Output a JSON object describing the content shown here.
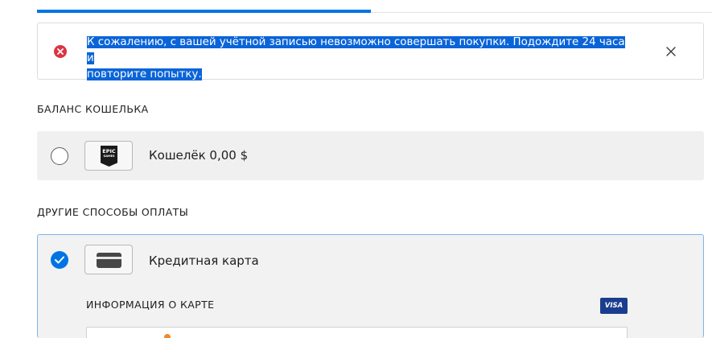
{
  "alert": {
    "type": "error",
    "message_line1": "К сожалению, с вашей учётной записью невозможно совершать покупки. Подождите 24 часа и",
    "message_line2": "повторите попытку.",
    "icons": {
      "status": "error-x-icon",
      "close": "close-icon"
    },
    "colors": {
      "error": "#de3341",
      "selection": "#0a64d8"
    }
  },
  "wallet_section": {
    "label": "БАЛАНС КОШЕЛЬКА",
    "option": {
      "label": "Кошелёк 0,00 $",
      "selected": false,
      "logo_text": "EPIC",
      "logo_subtext": "GAMES"
    }
  },
  "other_methods_section": {
    "label": "ДРУГИЕ СПОСОБЫ ОПЛАТЫ",
    "option": {
      "label": "Кредитная карта",
      "selected": true,
      "icon": "credit-card-icon",
      "card_info_label": "ИНФОРМАЦИЯ О КАРТЕ",
      "badge": "VISA"
    }
  },
  "colors": {
    "accent": "#0074e4",
    "option_bg": "#f0f0f0"
  }
}
